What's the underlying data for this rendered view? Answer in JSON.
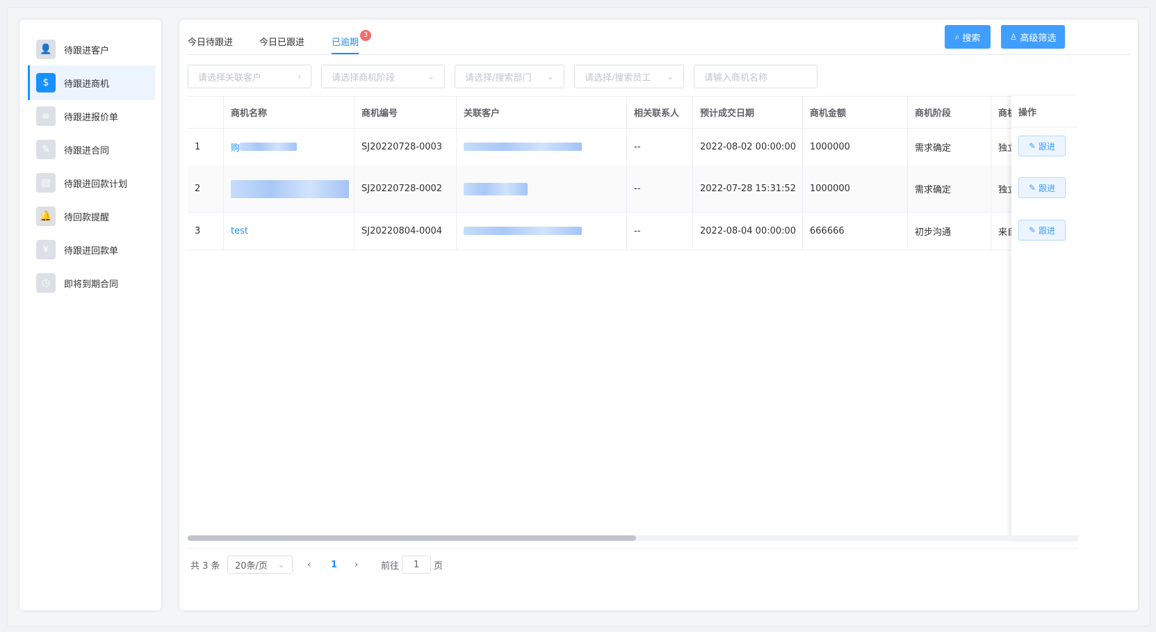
{
  "sidebar": {
    "items": [
      {
        "label": "待跟进客户",
        "icon": "customer-icon"
      },
      {
        "label": "待跟进商机",
        "icon": "opportunity-icon",
        "active": true
      },
      {
        "label": "待跟进报价单",
        "icon": "quote-icon"
      },
      {
        "label": "待跟进合同",
        "icon": "contract-icon"
      },
      {
        "label": "待跟进回款计划",
        "icon": "payment-plan-icon"
      },
      {
        "label": "待回款提醒",
        "icon": "bell-icon"
      },
      {
        "label": "待跟进回款单",
        "icon": "money-bag-icon"
      },
      {
        "label": "即将到期合同",
        "icon": "clock-icon"
      }
    ]
  },
  "tabs": [
    {
      "label": "今日待跟进"
    },
    {
      "label": "今日已跟进"
    },
    {
      "label": "已逾期",
      "badge": "3",
      "active": true
    }
  ],
  "toolbar": {
    "search_label": "搜索",
    "advanced_label": "高级筛选"
  },
  "filters": {
    "customer": "请选择关联客户",
    "stage": "请选择商机阶段",
    "department": "请选择/搜索部门",
    "employee": "请选择/搜索员工",
    "name": "请输入商机名称"
  },
  "table": {
    "headers": {
      "name": "商机名称",
      "code": "商机编号",
      "customer": "关联客户",
      "contact": "相关联系人",
      "date": "预计成交日期",
      "amount": "商机金额",
      "stage": "商机阶段",
      "extra": "商机",
      "op": "操作"
    },
    "rows": [
      {
        "idx": "1",
        "name": "购",
        "code": "SJ20220728-0003",
        "contact": "--",
        "date": "2022-08-02 00:00:00",
        "amount": "1000000",
        "stage": "需求确定",
        "extra": "独立"
      },
      {
        "idx": "2",
        "name": "",
        "code": "SJ20220728-0002",
        "contact": "--",
        "date": "2022-07-28 15:31:52",
        "amount": "1000000",
        "stage": "需求确定",
        "extra": "独立"
      },
      {
        "idx": "3",
        "name": "test",
        "code": "SJ20220804-0004",
        "contact": "--",
        "date": "2022-08-04 00:00:00",
        "amount": "666666",
        "stage": "初步沟通",
        "extra": "来自"
      }
    ],
    "follow_label": "跟进"
  },
  "pagination": {
    "total": "共 3 条",
    "page_size": "20条/页",
    "current": "1",
    "goto_prefix": "前往",
    "goto_value": "1",
    "goto_suffix": "页"
  },
  "colors": {
    "accent": "#1890ff",
    "badge": "#f56c6c"
  }
}
